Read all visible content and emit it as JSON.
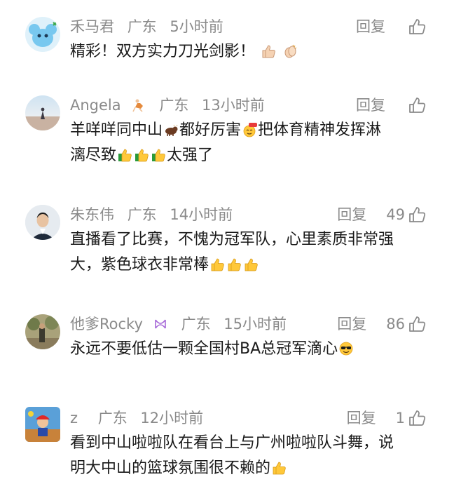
{
  "comments": [
    {
      "username": "禾马君",
      "location": "广东",
      "time": "5小时前",
      "reply_label": "回复",
      "likes": "",
      "text_lines": [
        "精彩！双方实力刀光剑影！"
      ]
    },
    {
      "username": "Angela",
      "location": "广东",
      "time": "13小时前",
      "reply_label": "回复",
      "likes": "",
      "text_a": "羊咩咩同中山",
      "text_b": "都好厉害",
      "text_c": "把体育精神发挥淋",
      "text_d": "漓尽致",
      "text_e": "太强了"
    },
    {
      "username": "朱东伟",
      "location": "广东",
      "time": "14小时前",
      "reply_label": "回复",
      "likes": "49",
      "text_line1": "直播看了比赛，不愧为冠军队，心里素质非常强",
      "text_line2": "大，紫色球衣非常棒"
    },
    {
      "username": "他爹Rocky",
      "location": "广东",
      "time": "15小时前",
      "reply_label": "回复",
      "likes": "86",
      "text_line1": "永远不要低估一颗全国村BA总冠军滴心"
    },
    {
      "username": "z",
      "location": "广东",
      "time": "12小时前",
      "reply_label": "回复",
      "likes": "1",
      "text_line1": "看到中山啦啦队在看台上与广州啦啦队斗舞，说",
      "text_line2": "明大中山的篮球氛围很不赖的"
    }
  ],
  "colors": {
    "meta": "#8a8a8a",
    "text": "#1a1a1a",
    "background": "#ffffff"
  }
}
